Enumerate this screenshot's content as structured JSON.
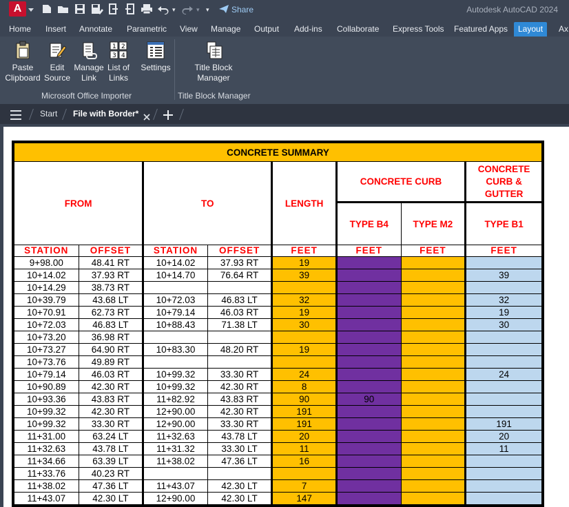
{
  "window": {
    "app_title": "Autodesk AutoCAD 2024",
    "logo_letter": "A",
    "share_label": "Share"
  },
  "menu": {
    "tabs": [
      "Home",
      "Insert",
      "Annotate",
      "Parametric",
      "View",
      "Manage",
      "Output",
      "Add-ins",
      "Collaborate",
      "Express Tools",
      "Featured Apps",
      "Layout",
      "Ax"
    ],
    "active_tab": "Layout"
  },
  "ribbon": {
    "buttons": [
      {
        "line1": "Paste",
        "line2": "Clipboard",
        "icon": "clipboard-icon"
      },
      {
        "line1": "Edit",
        "line2": "Source",
        "icon": "edit-source-icon"
      },
      {
        "line1": "Manage",
        "line2": "Link",
        "icon": "manage-link-icon"
      },
      {
        "line1": "List of",
        "line2": "Links",
        "icon": "list-links-icon"
      },
      {
        "line1": "Settings",
        "line2": "",
        "icon": "settings-icon"
      },
      {
        "line1": "Title Block",
        "line2": "Manager",
        "icon": "title-block-icon"
      }
    ],
    "panels": [
      "Microsoft Office Importer",
      "Title Block Manager"
    ]
  },
  "file_tabs": {
    "start_label": "Start",
    "active_label": "File with Border*"
  },
  "table": {
    "title": "CONCRETE SUMMARY",
    "headers": {
      "from": "FROM",
      "to": "TO",
      "length": "LENGTH",
      "concrete_curb": "CONCRETE CURB",
      "curb_gutter": "CONCRETE CURB & GUTTER",
      "type_b4": "TYPE B4",
      "type_m2": "TYPE M2",
      "type_b1": "TYPE B1"
    },
    "units": [
      "STATION",
      "OFFSET",
      "STATION",
      "OFFSET",
      "FEET",
      "FEET",
      "FEET",
      "FEET"
    ],
    "rows": [
      [
        "9+98.00",
        "48.41 RT",
        "10+14.02",
        "37.93 RT",
        "19",
        "",
        "",
        ""
      ],
      [
        "10+14.02",
        "37.93 RT",
        "10+14.70",
        "76.64 RT",
        "39",
        "",
        "",
        "39"
      ],
      [
        "10+14.29",
        "38.73 RT",
        "",
        "",
        "",
        "",
        "",
        ""
      ],
      [
        "10+39.79",
        "43.68 LT",
        "10+72.03",
        "46.83 LT",
        "32",
        "",
        "",
        "32"
      ],
      [
        "10+70.91",
        "62.73 RT",
        "10+79.14",
        "46.03 RT",
        "19",
        "",
        "",
        "19"
      ],
      [
        "10+72.03",
        "46.83 LT",
        "10+88.43",
        "71.38 LT",
        "30",
        "",
        "",
        "30"
      ],
      [
        "10+73.20",
        "36.98 RT",
        "",
        "",
        "",
        "",
        "",
        ""
      ],
      [
        "10+73.27",
        "64.90 RT",
        "10+83.30",
        "48.20 RT",
        "19",
        "",
        "",
        ""
      ],
      [
        "10+73.76",
        "49.89 RT",
        "",
        "",
        "",
        "",
        "",
        ""
      ],
      [
        "10+79.14",
        "46.03 RT",
        "10+99.32",
        "33.30 RT",
        "24",
        "",
        "",
        "24"
      ],
      [
        "10+90.89",
        "42.30 RT",
        "10+99.32",
        "42.30 RT",
        "8",
        "",
        "",
        ""
      ],
      [
        "10+93.36",
        "43.83 RT",
        "11+82.92",
        "43.83 RT",
        "90",
        "90",
        "",
        ""
      ],
      [
        "10+99.32",
        "42.30 RT",
        "12+90.00",
        "42.30 RT",
        "191",
        "",
        "",
        ""
      ],
      [
        "10+99.32",
        "33.30 RT",
        "12+90.00",
        "33.30 RT",
        "191",
        "",
        "",
        "191"
      ],
      [
        "11+31.00",
        "63.24 LT",
        "11+32.63",
        "43.78 LT",
        "20",
        "",
        "",
        "20"
      ],
      [
        "11+32.63",
        "43.78 LT",
        "11+31.32",
        "33.30 LT",
        "11",
        "",
        "",
        "11"
      ],
      [
        "11+34.66",
        "63.39 LT",
        "11+38.02",
        "47.36 LT",
        "16",
        "",
        "",
        ""
      ],
      [
        "11+33.76",
        "40.23 RT",
        "",
        "",
        "",
        "",
        "",
        ""
      ],
      [
        "11+38.02",
        "47.36 LT",
        "11+43.07",
        "42.30 LT",
        "7",
        "",
        "",
        ""
      ],
      [
        "11+43.07",
        "42.30 LT",
        "12+90.00",
        "42.30 LT",
        "147",
        "",
        "",
        ""
      ]
    ]
  },
  "colors": {
    "length_fill": "#ffc000",
    "type_b4_fill": "#7030a0",
    "type_m2_fill": "#ffc000",
    "type_b1_fill": "#bdd7ee",
    "header_text": "#ff0000",
    "active_tab": "#2f89d6"
  }
}
